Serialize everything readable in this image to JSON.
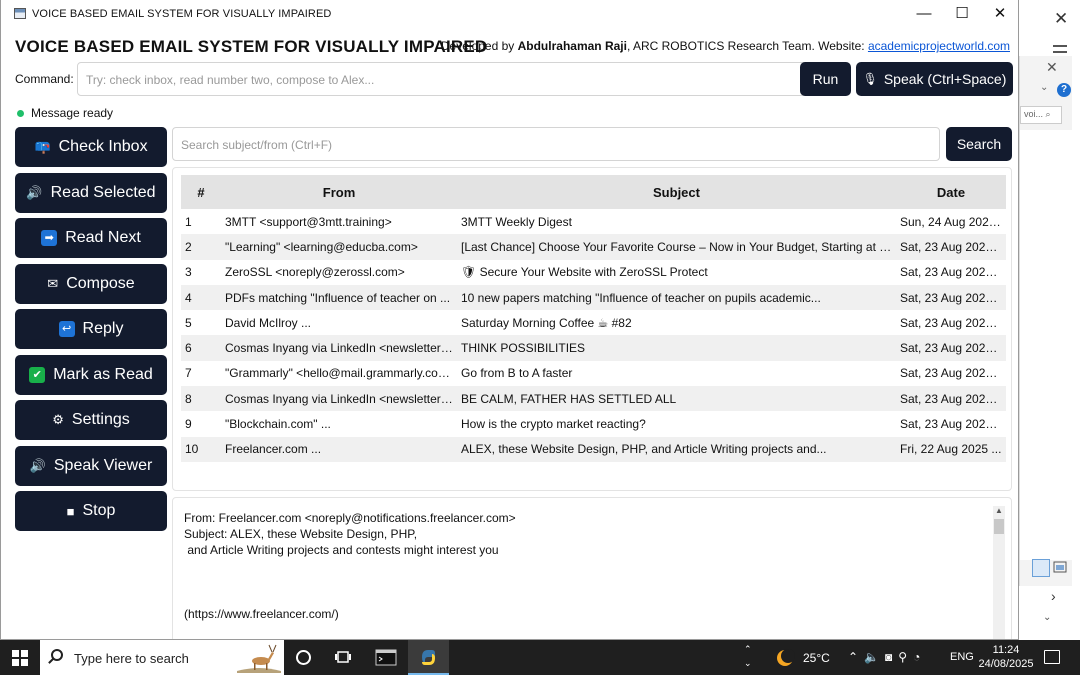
{
  "window": {
    "title": "VOICE BASED EMAIL SYSTEM FOR VISUALLY IMPAIRED",
    "controls": {
      "minimize": "—",
      "maximize": "☐",
      "close": "✕"
    }
  },
  "header": {
    "title": "VOICE BASED EMAIL SYSTEM FOR VISUALLY IMPAIRED",
    "dev_prefix": "Developed by ",
    "dev_name": "Abdulrahaman Raji",
    "dev_suffix": ", ARC ROBOTICS Research Team. Website: ",
    "website": "academicprojectworld.com"
  },
  "command": {
    "label": "Command:",
    "placeholder": "Try: check inbox, read number two, compose to Alex...",
    "run_label": "Run",
    "speak_label": "Speak (Ctrl+Space)"
  },
  "status": {
    "text": "Message ready",
    "color": "#1fbf6a"
  },
  "sidebar": {
    "items": [
      {
        "label": "Check Inbox",
        "icon": "📪"
      },
      {
        "label": "Read Selected",
        "icon": "🔊"
      },
      {
        "label": "Read Next",
        "icon": "➡"
      },
      {
        "label": "Compose",
        "icon": "✉"
      },
      {
        "label": "Reply",
        "icon": "↩"
      },
      {
        "label": "Mark as Read",
        "icon": "✔"
      },
      {
        "label": "Settings",
        "icon": "⚙"
      },
      {
        "label": "Speak Viewer",
        "icon": "🔊"
      },
      {
        "label": "Stop",
        "icon": "■"
      }
    ]
  },
  "search": {
    "placeholder": "Search subject/from (Ctrl+F)",
    "button_label": "Search"
  },
  "table": {
    "headers": [
      "#",
      "From",
      "Subject",
      "Date"
    ],
    "rows": [
      {
        "num": "1",
        "from": "3MTT <support@3mtt.training>",
        "subject": "3MTT Weekly Digest",
        "date": "Sun, 24 Aug 2025..."
      },
      {
        "num": "2",
        "from": "\"Learning\" <learning@educba.com>",
        "subject": "[Last Chance] Choose Your Favorite Course – Now in Your Budget, Starting at Just...",
        "date": "Sat, 23 Aug 2025 ..."
      },
      {
        "num": "3",
        "from": "ZeroSSL <noreply@zerossl.com>",
        "subject": "🛡 Secure Your Website with ZeroSSL Protect",
        "date": "Sat, 23 Aug 2025 ..."
      },
      {
        "num": "4",
        "from": "PDFs matching \"Influence of teacher on ...",
        "subject": "10 new papers matching \"Influence of teacher on pupils academic...",
        "date": "Sat, 23 Aug 2025 ..."
      },
      {
        "num": "5",
        "from": "David McIlroy ...",
        "subject": "Saturday Morning Coffee ☕ #82",
        "date": "Sat, 23 Aug 2025 ..."
      },
      {
        "num": "6",
        "from": "Cosmas Inyang via LinkedIn <newsletters-...",
        "subject": "THINK POSSIBILITIES",
        "date": "Sat, 23 Aug 2025 ..."
      },
      {
        "num": "7",
        "from": "\"Grammarly\" <hello@mail.grammarly.com>",
        "subject": "Go from B to A faster",
        "date": "Sat, 23 Aug 2025 ..."
      },
      {
        "num": "8",
        "from": "Cosmas Inyang via LinkedIn <newsletters-...",
        "subject": "BE CALM, FATHER HAS SETTLED ALL",
        "date": "Sat, 23 Aug 2025 ..."
      },
      {
        "num": "9",
        "from": "\"Blockchain.com\" ...",
        "subject": "How is the crypto market reacting?",
        "date": "Sat, 23 Aug 2025 ..."
      },
      {
        "num": "10",
        "from": "Freelancer.com ...",
        "subject": "ALEX, these Website Design, PHP, and Article Writing projects and...",
        "date": "Fri, 22 Aug 2025 ..."
      }
    ]
  },
  "preview": {
    "lines": [
      "From: Freelancer.com <noreply@notifications.freelancer.com>",
      "Subject: ALEX, these Website Design, PHP,",
      " and Article Writing projects and contests might interest you",
      "(https://www.freelancer.com/)"
    ]
  },
  "background_window": {
    "search_text": "voi..."
  },
  "taskbar": {
    "search_placeholder": "Type here to search",
    "temperature": "25°C",
    "language": "ENG",
    "time": "11:24",
    "date": "24/08/2025"
  }
}
